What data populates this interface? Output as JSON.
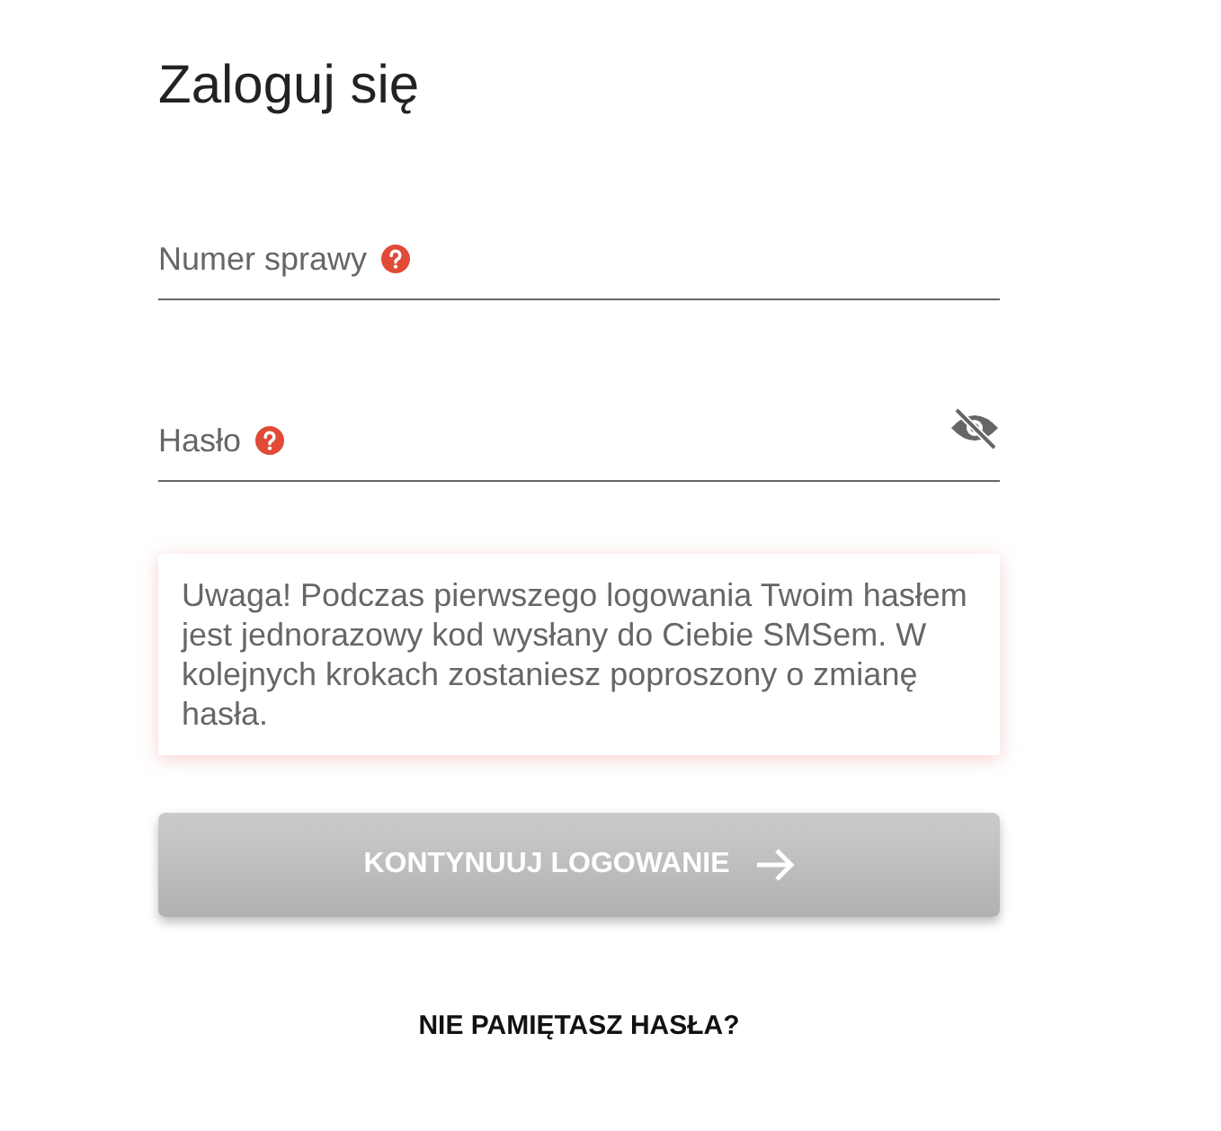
{
  "title": "Zaloguj się",
  "fields": [
    {
      "label": "Numer sprawy",
      "kind": "text"
    },
    {
      "label": "Hasło",
      "kind": "password",
      "password_visible": false
    }
  ],
  "notice": "Uwaga! Podczas pierwszego logowania Twoim hasłem jest jednorazowy kod wysłany do Ciebie SMSem. W kolejnych krokach zostaniesz poproszony o zmianę hasła.",
  "submit": {
    "label": "KONTYNUUJ LOGOWANIE",
    "disabled": true
  },
  "forgot_link": "NIE PAMIĘTASZ HASŁA?"
}
